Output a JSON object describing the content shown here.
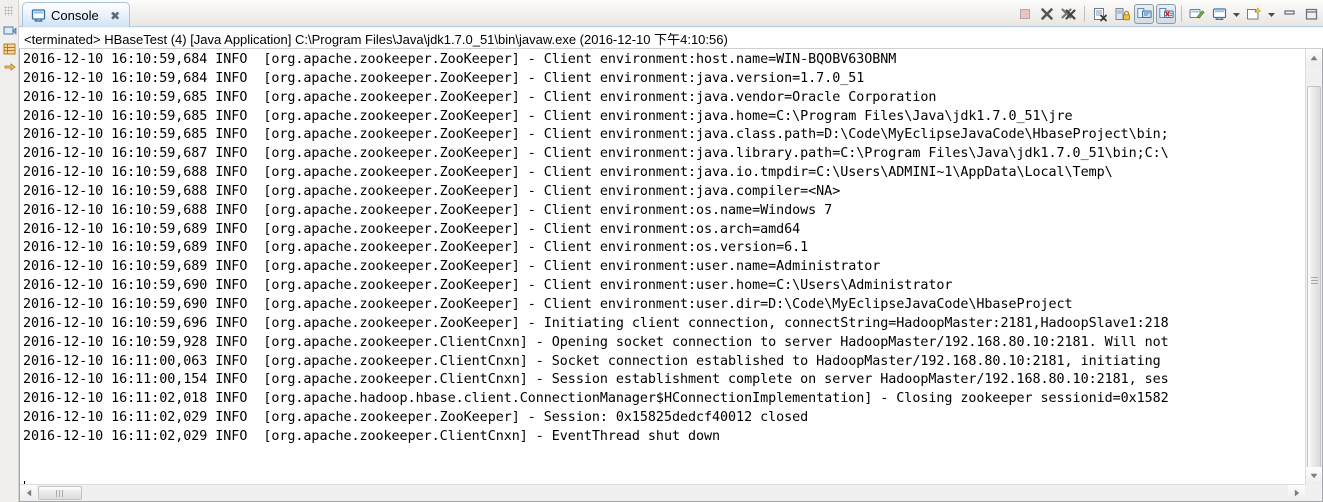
{
  "window": {
    "tab_label": "Console",
    "tab_icon": "console-icon",
    "tab_close_glyph": "✖"
  },
  "toolbar": {
    "buttons": [
      {
        "name": "terminate-button",
        "icon": "terminate-icon",
        "enabled": false,
        "pressed": false
      },
      {
        "name": "remove-launch-button",
        "icon": "remove-launch-icon",
        "enabled": true,
        "pressed": false
      },
      {
        "name": "remove-all-terminated-button",
        "icon": "remove-all-terminated-icon",
        "enabled": true,
        "pressed": false
      },
      {
        "name": "clear-console-button",
        "icon": "clear-console-icon",
        "enabled": true,
        "pressed": false
      },
      {
        "name": "scroll-lock-button",
        "icon": "scroll-lock-icon",
        "enabled": true,
        "pressed": false
      },
      {
        "name": "show-console-on-output-button",
        "icon": "show-console-output-icon",
        "enabled": true,
        "pressed": true
      },
      {
        "name": "show-console-on-error-button",
        "icon": "show-console-error-icon",
        "enabled": true,
        "pressed": true
      },
      {
        "name": "pin-console-button",
        "icon": "pin-console-icon",
        "enabled": true,
        "pressed": false
      },
      {
        "name": "display-selected-console-button",
        "icon": "display-selected-console-icon",
        "enabled": true,
        "pressed": false
      },
      {
        "name": "open-console-button",
        "icon": "open-console-icon",
        "enabled": true,
        "pressed": false
      }
    ],
    "menu_arrow_glyph": "▼",
    "minimize_label": "Minimize",
    "maximize_label": "Maximize"
  },
  "process": {
    "line": "<terminated> HBaseTest (4) [Java Application] C:\\Program Files\\Java\\jdk1.7.0_51\\bin\\javaw.exe (2016-12-10 下午4:10:56)"
  },
  "console": {
    "lines": [
      "2016-12-10 16:10:59,684 INFO  [org.apache.zookeeper.ZooKeeper] - Client environment:host.name=WIN-BQOBV63OBNM",
      "2016-12-10 16:10:59,684 INFO  [org.apache.zookeeper.ZooKeeper] - Client environment:java.version=1.7.0_51",
      "2016-12-10 16:10:59,685 INFO  [org.apache.zookeeper.ZooKeeper] - Client environment:java.vendor=Oracle Corporation",
      "2016-12-10 16:10:59,685 INFO  [org.apache.zookeeper.ZooKeeper] - Client environment:java.home=C:\\Program Files\\Java\\jdk1.7.0_51\\jre",
      "2016-12-10 16:10:59,685 INFO  [org.apache.zookeeper.ZooKeeper] - Client environment:java.class.path=D:\\Code\\MyEclipseJavaCode\\HbaseProject\\bin;",
      "2016-12-10 16:10:59,687 INFO  [org.apache.zookeeper.ZooKeeper] - Client environment:java.library.path=C:\\Program Files\\Java\\jdk1.7.0_51\\bin;C:\\",
      "2016-12-10 16:10:59,688 INFO  [org.apache.zookeeper.ZooKeeper] - Client environment:java.io.tmpdir=C:\\Users\\ADMINI~1\\AppData\\Local\\Temp\\",
      "2016-12-10 16:10:59,688 INFO  [org.apache.zookeeper.ZooKeeper] - Client environment:java.compiler=<NA>",
      "2016-12-10 16:10:59,688 INFO  [org.apache.zookeeper.ZooKeeper] - Client environment:os.name=Windows 7",
      "2016-12-10 16:10:59,689 INFO  [org.apache.zookeeper.ZooKeeper] - Client environment:os.arch=amd64",
      "2016-12-10 16:10:59,689 INFO  [org.apache.zookeeper.ZooKeeper] - Client environment:os.version=6.1",
      "2016-12-10 16:10:59,689 INFO  [org.apache.zookeeper.ZooKeeper] - Client environment:user.name=Administrator",
      "2016-12-10 16:10:59,690 INFO  [org.apache.zookeeper.ZooKeeper] - Client environment:user.home=C:\\Users\\Administrator",
      "2016-12-10 16:10:59,690 INFO  [org.apache.zookeeper.ZooKeeper] - Client environment:user.dir=D:\\Code\\MyEclipseJavaCode\\HbaseProject",
      "2016-12-10 16:10:59,696 INFO  [org.apache.zookeeper.ZooKeeper] - Initiating client connection, connectString=HadoopMaster:2181,HadoopSlave1:218",
      "2016-12-10 16:10:59,928 INFO  [org.apache.zookeeper.ClientCnxn] - Opening socket connection to server HadoopMaster/192.168.80.10:2181. Will not",
      "2016-12-10 16:11:00,063 INFO  [org.apache.zookeeper.ClientCnxn] - Socket connection established to HadoopMaster/192.168.80.10:2181, initiating",
      "2016-12-10 16:11:00,154 INFO  [org.apache.zookeeper.ClientCnxn] - Session establishment complete on server HadoopMaster/192.168.80.10:2181, ses",
      "2016-12-10 16:11:02,018 INFO  [org.apache.hadoop.hbase.client.ConnectionManager$HConnectionImplementation] - Closing zookeeper sessionid=0x1582",
      "2016-12-10 16:11:02,029 INFO  [org.apache.zookeeper.ZooKeeper] - Session: 0x15825dedcf40012 closed",
      "2016-12-10 16:11:02,029 INFO  [org.apache.zookeeper.ClientCnxn] - EventThread shut down"
    ]
  },
  "scrollbars": {
    "vertical": {
      "up_glyph": "▲",
      "down_glyph": "▼"
    },
    "horizontal": {
      "left_glyph": "◀",
      "right_glyph": "▶"
    }
  },
  "colors": {
    "tab_active": "#cfe2f4",
    "console_bg": "#ffffff",
    "text": "#000000",
    "chrome": "#f1efed"
  }
}
